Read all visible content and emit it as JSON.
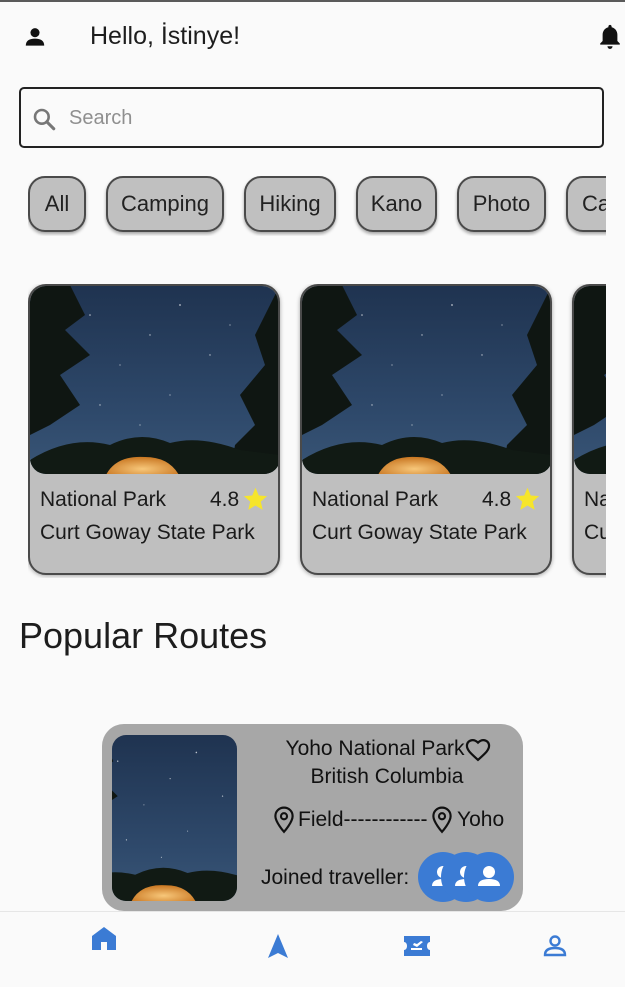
{
  "header": {
    "greeting": "Hello, İstinye!",
    "icons": [
      "person-icon",
      "bell-icon"
    ]
  },
  "search": {
    "placeholder": "Search",
    "value": ""
  },
  "categories": [
    "All",
    "Camping",
    "Hiking",
    "Kano",
    "Photo",
    "Ca"
  ],
  "places": [
    {
      "type": "National Park",
      "rating": "4.8",
      "name": "Curt Goway State Park"
    },
    {
      "type": "National Park",
      "rating": "4.8",
      "name": "Curt Goway State Park"
    },
    {
      "type": "Na",
      "rating": "",
      "name": "Cu"
    }
  ],
  "popular_routes": {
    "title": "Popular Routes",
    "routes": [
      {
        "title": "Yoho National Park",
        "subtitle": "British Columbia",
        "from": "Field------------",
        "to": "Yoho",
        "joined_label": "Joined traveller:"
      }
    ]
  },
  "bottom_nav": {
    "items": [
      "home-icon",
      "navigation-icon",
      "ticket-icon",
      "profile-icon"
    ],
    "active": "home-icon"
  },
  "colors": {
    "accent": "#3b7bd4",
    "card_bg": "#bfbfbf",
    "route_bg": "#a7a7a7",
    "star": "#f6e52b"
  }
}
